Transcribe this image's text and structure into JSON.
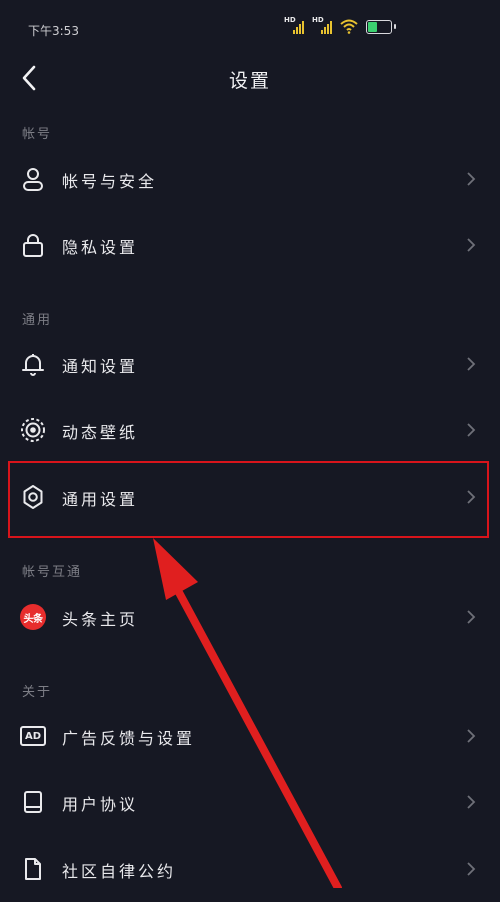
{
  "status_bar": {
    "time": "下午3:53",
    "network_1": "HD",
    "network_2": "HD"
  },
  "header": {
    "title": "设置"
  },
  "sections": [
    {
      "label": "帐号",
      "items": [
        {
          "label": "帐号与安全",
          "icon": "user-icon"
        },
        {
          "label": "隐私设置",
          "icon": "lock-icon"
        }
      ]
    },
    {
      "label": "通用",
      "items": [
        {
          "label": "通知设置",
          "icon": "bell-icon"
        },
        {
          "label": "动态壁纸",
          "icon": "live-wallpaper-icon"
        },
        {
          "label": "通用设置",
          "icon": "gear-icon"
        }
      ]
    },
    {
      "label": "帐号互通",
      "items": [
        {
          "label": "头条主页",
          "icon": "toutiao-icon",
          "badge": "头条"
        }
      ]
    },
    {
      "label": "关于",
      "items": [
        {
          "label": "广告反馈与设置",
          "icon": "ad-icon",
          "badge": "AD"
        },
        {
          "label": "用户协议",
          "icon": "book-icon"
        },
        {
          "label": "社区自律公约",
          "icon": "document-icon"
        }
      ]
    }
  ],
  "colors": {
    "background": "#161823",
    "highlight_box": "#d8141b",
    "arrow": "#e01f1f"
  }
}
